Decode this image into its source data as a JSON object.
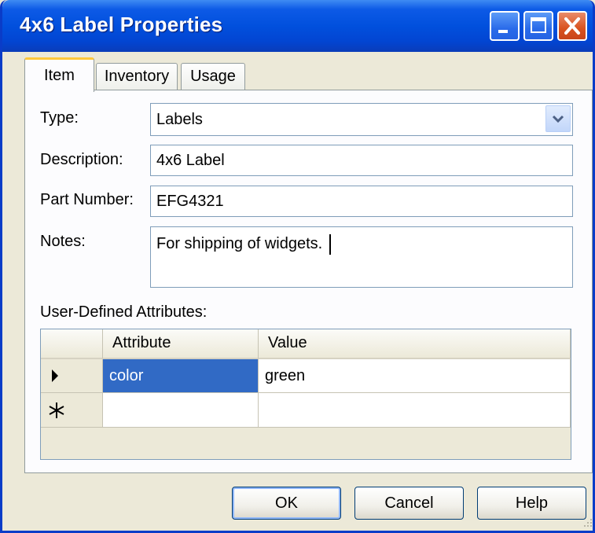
{
  "window": {
    "title": "4x6 Label Properties",
    "buttons": {
      "minimize": "minimize-icon",
      "maximize": "maximize-icon",
      "close": "close-icon"
    }
  },
  "tabs": [
    {
      "label": "Item",
      "active": true
    },
    {
      "label": "Inventory",
      "active": false
    },
    {
      "label": "Usage",
      "active": false
    }
  ],
  "form": {
    "type_label": "Type:",
    "type_value": "Labels",
    "description_label": "Description:",
    "description_value": "4x6 Label",
    "part_number_label": "Part Number:",
    "part_number_value": "EFG4321",
    "notes_label": "Notes:",
    "notes_value": "For shipping of widgets."
  },
  "attributes": {
    "section_label": "User-Defined Attributes:",
    "columns": [
      "Attribute",
      "Value"
    ],
    "rows": [
      {
        "indicator": "current-row-arrow-icon",
        "attribute": "color",
        "value": "green",
        "selected_cell": "attribute"
      },
      {
        "indicator": "new-row-asterisk-icon",
        "attribute": "",
        "value": ""
      }
    ]
  },
  "footer": {
    "ok_label": "OK",
    "cancel_label": "Cancel",
    "help_label": "Help"
  },
  "colors": {
    "titlebar": "#0150dd",
    "close_button": "#d9521f",
    "selection": "#316ac5",
    "active_tab_accent": "#ffc83c"
  }
}
